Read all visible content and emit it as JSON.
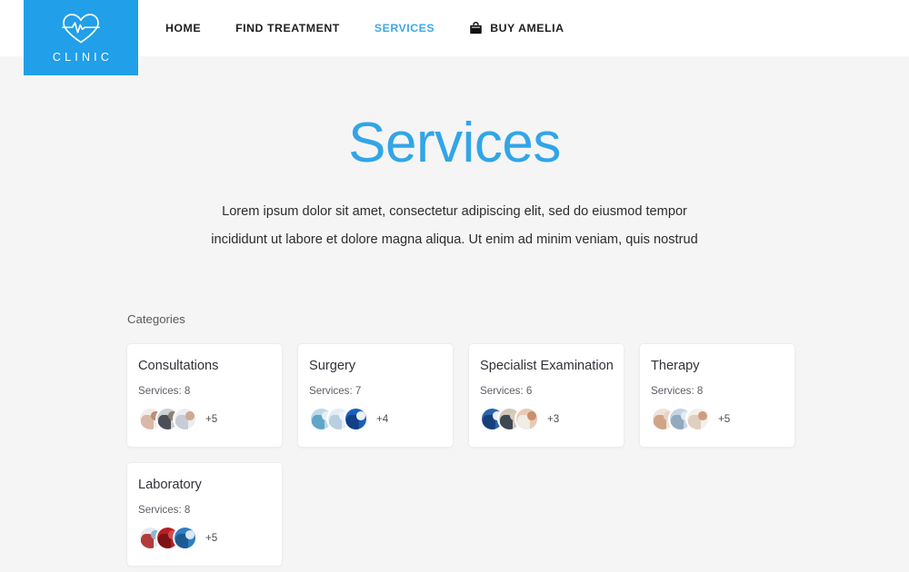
{
  "brand": {
    "logo_text": "CLINIC",
    "logo_icon": "heart-pulse-icon",
    "logo_bg_color": "#219fe8"
  },
  "nav": {
    "items": [
      {
        "label": "HOME",
        "active": false,
        "icon": null
      },
      {
        "label": "FIND TREATMENT",
        "active": false,
        "icon": null
      },
      {
        "label": "SERVICES",
        "active": true,
        "icon": null
      },
      {
        "label": "BUY AMELIA",
        "active": false,
        "icon": "shopping-bag-icon"
      }
    ],
    "active_color": "#3ea8e5"
  },
  "hero": {
    "title": "Services",
    "title_color": "#32a5e7",
    "description": "Lorem ipsum dolor sit amet, consectetur adipiscing elit, sed do eiusmod tempor incididunt ut labore et dolore magna aliqua. Ut enim ad minim veniam, quis nostrud"
  },
  "categories": {
    "label": "Categories",
    "cards": [
      {
        "title": "Consultations",
        "services_label": "Services: 8",
        "more_label": "+5",
        "avatars": [
          {
            "name": "avatar-consultations-1",
            "c1": "#f3ece9",
            "c2": "#d8b9a8",
            "c3": "#b98f78"
          },
          {
            "name": "avatar-consultations-2",
            "c1": "#cdd2d8",
            "c2": "#4a4f58",
            "c3": "#8f7f6f"
          },
          {
            "name": "avatar-consultations-3",
            "c1": "#eceef2",
            "c2": "#c7ccd6",
            "c3": "#cfa98f"
          }
        ]
      },
      {
        "title": "Surgery",
        "services_label": "Services: 7",
        "more_label": "+4",
        "avatars": [
          {
            "name": "avatar-surgery-1",
            "c1": "#bcd8e8",
            "c2": "#5fa6c8",
            "c3": "#e7eff4"
          },
          {
            "name": "avatar-surgery-2",
            "c1": "#e4edf4",
            "c2": "#b8cfe0",
            "c3": "#f0f5f9"
          },
          {
            "name": "avatar-surgery-3",
            "c1": "#1b5fbe",
            "c2": "#123f85",
            "c3": "#eceff3"
          }
        ]
      },
      {
        "title": "Specialist Examination",
        "services_label": "Services: 6",
        "more_label": "+3",
        "avatars": [
          {
            "name": "avatar-specialist-1",
            "c1": "#2b63ad",
            "c2": "#16407a",
            "c3": "#e8eef5"
          },
          {
            "name": "avatar-specialist-2",
            "c1": "#cfc7b8",
            "c2": "#3f4754",
            "c3": "#d8cbb9"
          },
          {
            "name": "avatar-specialist-3",
            "c1": "#e8c9b4",
            "c2": "#f0ece6",
            "c3": "#c98f6d"
          }
        ]
      },
      {
        "title": "Therapy",
        "services_label": "Services: 8",
        "more_label": "+5",
        "avatars": [
          {
            "name": "avatar-therapy-1",
            "c1": "#efe3d8",
            "c2": "#cfa489",
            "c3": "#e6d6c6"
          },
          {
            "name": "avatar-therapy-2",
            "c1": "#c5d3e2",
            "c2": "#93a9c0",
            "c3": "#e3ecf4"
          },
          {
            "name": "avatar-therapy-3",
            "c1": "#f3efe9",
            "c2": "#e0cfc0",
            "c3": "#cf9c7f"
          }
        ]
      },
      {
        "title": "Laboratory",
        "services_label": "Services: 8",
        "more_label": "+5",
        "avatars": [
          {
            "name": "avatar-laboratory-1",
            "c1": "#e3e9ee",
            "c2": "#b23a3a",
            "c3": "#8fb4cf"
          },
          {
            "name": "avatar-laboratory-2",
            "c1": "#b51f24",
            "c2": "#7d1216",
            "c3": "#d84a4a"
          },
          {
            "name": "avatar-laboratory-3",
            "c1": "#2f7fc4",
            "c2": "#1d5a93",
            "c3": "#dbe7f2"
          }
        ]
      }
    ]
  },
  "theme": {
    "page_background": "#f5f5f5",
    "card_background": "#ffffff",
    "card_border": "#ededed"
  }
}
